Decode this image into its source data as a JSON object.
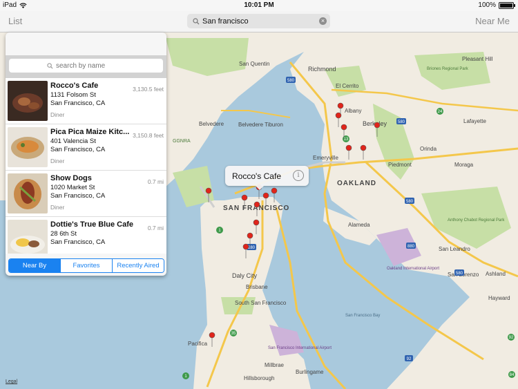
{
  "statusbar": {
    "device": "iPad",
    "time": "10:01 PM",
    "battery": "100%"
  },
  "navbar": {
    "list_label": "List",
    "near_me_label": "Near Me",
    "search_value": "San francisco"
  },
  "popover": {
    "search_placeholder": "search by name",
    "rows": [
      {
        "name": "Rocco's Cafe",
        "street": "1131 Folsom St",
        "city": "San Francisco, CA",
        "category": "Diner",
        "distance": "3,130.5 feet"
      },
      {
        "name": "Pica Pica Maize Kitc...",
        "street": "401 Valencia St",
        "city": "San Francisco, CA",
        "category": "Diner",
        "distance": "3,150.8 feet"
      },
      {
        "name": "Show Dogs",
        "street": "1020 Market St",
        "city": "San Francisco, CA",
        "category": "Diner",
        "distance": "0.7 mi"
      },
      {
        "name": "Dottie's True Blue Cafe",
        "street": "28 6th St",
        "city": "San Francisco, CA",
        "category": "",
        "distance": "0.7 mi"
      }
    ],
    "segments": [
      "Near By",
      "Favorites",
      "Recently Aired"
    ]
  },
  "callout": {
    "title": "Rocco's Cafe"
  },
  "map": {
    "legal": "Legal",
    "labels": {
      "oakland": "OAKLAND",
      "san_francisco": "SAN FRANCISCO",
      "richmond": "Richmond",
      "san_quentin": "San Quentin",
      "el_cerrito": "El Cerrito",
      "albany": "Albany",
      "berkeley": "Berkeley",
      "emeryville": "Emeryville",
      "piedmont": "Piedmont",
      "moraga": "Moraga",
      "orinda": "Orinda",
      "lafayette": "Lafayette",
      "pleasant_hill": "Pleasant Hill",
      "briones": "Briones Regional Park",
      "belvedere_city": "Belvedere",
      "belvedere_tiburon": "Belvedere Tiburon",
      "ggnra": "GGNRA",
      "alameda": "Alameda",
      "anthony_chabot": "Anthony Chabot Regional Park",
      "san_leandro": "San Leandro",
      "oakland_airport": "Oakland International Airport",
      "daly_city": "Daly City",
      "brisbane": "Brisbane",
      "south_sf": "South San Francisco",
      "sf_bay": "San Francisco Bay",
      "sf_airport": "San Francisco International Airport",
      "san_lorenzo": "San Lorenzo",
      "hayward": "Hayward",
      "pacifica": "Pacifica",
      "millbrae": "Millbrae",
      "hillsborough": "Hillsborough",
      "burlingame": "Burlingame",
      "ashland": "Ashland"
    }
  },
  "colors": {
    "accent": "#1a82f0",
    "pin": "#e0251b",
    "water": "#a9c9dd",
    "land": "#f1ece2",
    "park": "#c7dfa6"
  }
}
